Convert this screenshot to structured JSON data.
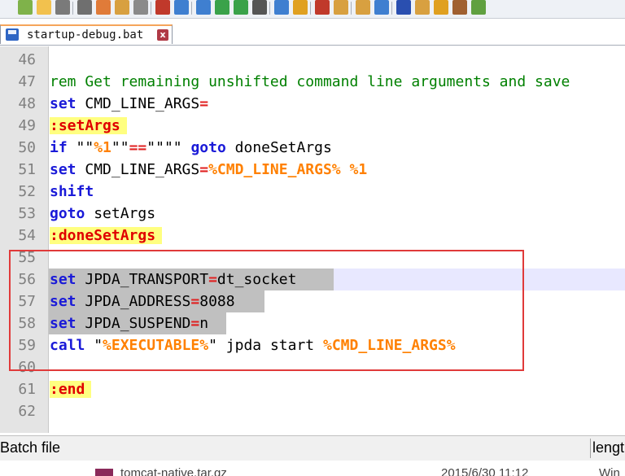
{
  "toolbar": {
    "icons": [
      "new-file",
      "open-file",
      "save",
      "save-all",
      "close",
      "close-all",
      "print",
      "cut",
      "copy",
      "paste",
      "undo",
      "redo",
      "find",
      "replace",
      "zoom-in",
      "zoom-out",
      "sync-vertical",
      "sync-horizontal",
      "word-wrap",
      "show-all-chars",
      "indent-guide",
      "user-lang",
      "doc-map",
      "macro"
    ]
  },
  "tab": {
    "label": "startup-debug.bat",
    "close": "x"
  },
  "editor": {
    "lines": [
      {
        "n": "46",
        "segs": []
      },
      {
        "n": "47",
        "segs": [
          {
            "t": "rem Get remaining unshifted command line arguments and save",
            "c": "cm"
          }
        ]
      },
      {
        "n": "48",
        "segs": [
          {
            "t": "set",
            "c": "kw"
          },
          {
            "t": " CMD_LINE_ARGS",
            "c": "plain"
          },
          {
            "t": "=",
            "c": "op"
          }
        ]
      },
      {
        "n": "49",
        "segs": [
          {
            "t": ":setArgs",
            "c": "lbl"
          }
        ]
      },
      {
        "n": "50",
        "segs": [
          {
            "t": "if",
            "c": "kw"
          },
          {
            "t": " \"\"",
            "c": "plain"
          },
          {
            "t": "%1",
            "c": "var"
          },
          {
            "t": "\"\"",
            "c": "plain"
          },
          {
            "t": "==",
            "c": "op"
          },
          {
            "t": "\"\"\"\" ",
            "c": "plain"
          },
          {
            "t": "goto",
            "c": "kw"
          },
          {
            "t": " doneSetArgs",
            "c": "plain"
          }
        ]
      },
      {
        "n": "51",
        "segs": [
          {
            "t": "set",
            "c": "kw"
          },
          {
            "t": " CMD_LINE_ARGS",
            "c": "plain"
          },
          {
            "t": "=",
            "c": "op"
          },
          {
            "t": "%CMD_LINE_ARGS%",
            "c": "var"
          },
          {
            "t": " ",
            "c": "plain"
          },
          {
            "t": "%1",
            "c": "var"
          }
        ]
      },
      {
        "n": "52",
        "segs": [
          {
            "t": "shift",
            "c": "kw"
          }
        ]
      },
      {
        "n": "53",
        "segs": [
          {
            "t": "goto",
            "c": "kw"
          },
          {
            "t": " setArgs",
            "c": "plain"
          }
        ]
      },
      {
        "n": "54",
        "segs": [
          {
            "t": ":doneSetArgs",
            "c": "lbl"
          }
        ]
      },
      {
        "n": "55",
        "segs": []
      },
      {
        "n": "56",
        "segs": [
          {
            "t": "set",
            "c": "kw"
          },
          {
            "t": " JPDA_TRANSPORT",
            "c": "plain"
          },
          {
            "t": "=",
            "c": "op"
          },
          {
            "t": "dt_socket",
            "c": "plain"
          }
        ],
        "current": true
      },
      {
        "n": "57",
        "segs": [
          {
            "t": "set",
            "c": "kw"
          },
          {
            "t": " JPDA_ADDRESS",
            "c": "plain"
          },
          {
            "t": "=",
            "c": "op"
          },
          {
            "t": "8088",
            "c": "plain"
          }
        ]
      },
      {
        "n": "58",
        "segs": [
          {
            "t": "set",
            "c": "kw"
          },
          {
            "t": " JPDA_SUSPEND",
            "c": "plain"
          },
          {
            "t": "=",
            "c": "op"
          },
          {
            "t": "n",
            "c": "plain"
          }
        ]
      },
      {
        "n": "59",
        "segs": [
          {
            "t": "call",
            "c": "kw"
          },
          {
            "t": " \"",
            "c": "plain"
          },
          {
            "t": "%EXECUTABLE%",
            "c": "var"
          },
          {
            "t": "\" jpda start ",
            "c": "plain"
          },
          {
            "t": "%CMD_LINE_ARGS%",
            "c": "var"
          }
        ]
      },
      {
        "n": "60",
        "segs": []
      },
      {
        "n": "61",
        "segs": [
          {
            "t": ":end",
            "c": "lbl"
          }
        ]
      },
      {
        "n": "62",
        "segs": []
      }
    ]
  },
  "status": {
    "file_type": "Batch file",
    "length_label": "lengt"
  },
  "background_window": {
    "file_name": "tomcat-native.tar.gz",
    "date": "2015/6/30 11:12",
    "type": "Win"
  }
}
